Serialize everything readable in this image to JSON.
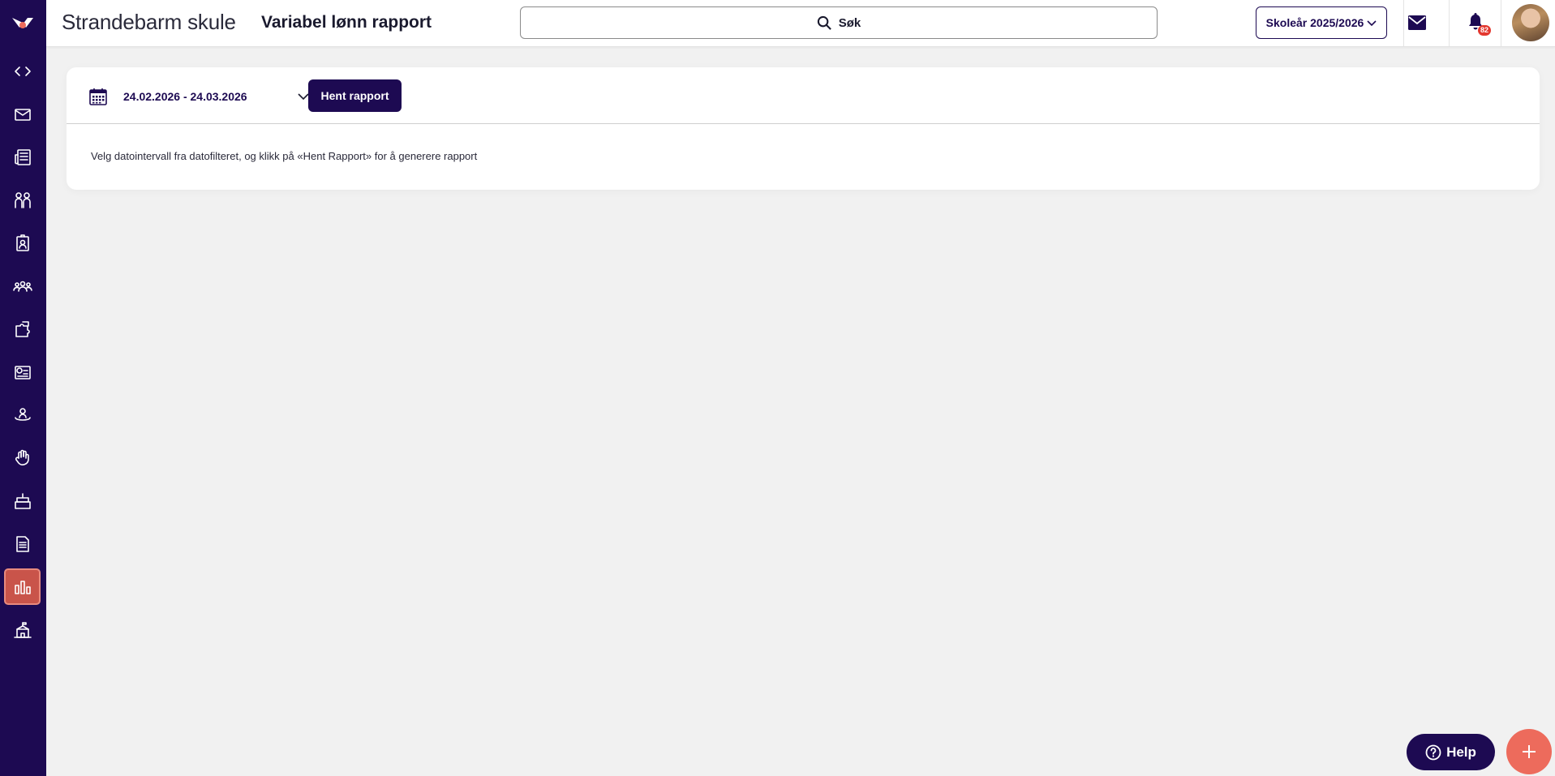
{
  "header": {
    "school_name": "Strandebarm skule",
    "page_title": "Variabel lønn rapport",
    "search_placeholder": "Søk",
    "school_year": "Skoleår 2025/2026",
    "notification_count": "82"
  },
  "sidebar": {
    "items": [
      {
        "name": "code",
        "icon": "code-icon"
      },
      {
        "name": "messages",
        "icon": "mail-icon"
      },
      {
        "name": "news",
        "icon": "newspaper-icon"
      },
      {
        "name": "groups",
        "icon": "people-icon"
      },
      {
        "name": "badge",
        "icon": "id-badge-icon"
      },
      {
        "name": "users",
        "icon": "users-group-icon"
      },
      {
        "name": "planner",
        "icon": "puzzle-icon"
      },
      {
        "name": "reports-chat",
        "icon": "chat-chart-icon"
      },
      {
        "name": "wellbeing",
        "icon": "person-hands-icon"
      },
      {
        "name": "activities",
        "icon": "hand-icon"
      },
      {
        "name": "events",
        "icon": "cake-icon"
      },
      {
        "name": "documents",
        "icon": "document-icon"
      },
      {
        "name": "statistics",
        "icon": "bar-chart-icon",
        "active": true
      },
      {
        "name": "school",
        "icon": "school-icon"
      }
    ],
    "active_color": "#c9544a"
  },
  "report": {
    "date_range": "24.02.2026 - 24.03.2026",
    "fetch_button": "Hent rapport",
    "info_text": "Velg datointervall fra datofilteret, og klikk på «Hent Rapport» for å generere rapport"
  },
  "floating": {
    "help_label": "Help"
  },
  "colors": {
    "primary": "#1d0a52",
    "accent": "#ed6b5c",
    "badge": "#e3382f"
  }
}
